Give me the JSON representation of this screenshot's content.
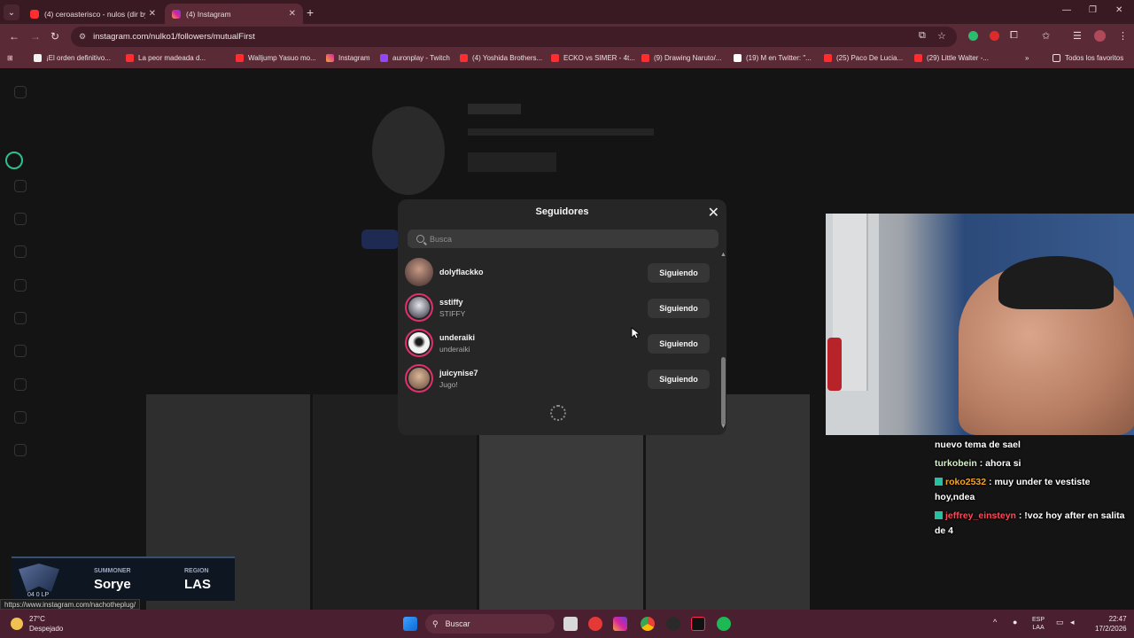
{
  "browser": {
    "tabs": [
      {
        "title": "(4) ceroasterisco - nulos (dir by",
        "active": false
      },
      {
        "title": "(4) Instagram",
        "active": true
      }
    ],
    "url": "instagram.com/nulko1/followers/mutualFirst",
    "bookmarks": [
      "¡El orden definitivo...",
      "La peor madeada d...",
      "Walljump Yasuo mo...",
      "Instagram",
      "auronplay - Twitch",
      "(4) Yoshida Brothers...",
      "ECKO vs SIMER - 4t...",
      "(9) Drawing Naruto/...",
      "(19) M en Twitter: \"...",
      "(25) Paco De Lucia...",
      "(29) Little Walter -..."
    ],
    "bookmarks_all": "Todos los favoritos"
  },
  "modal": {
    "title": "Seguidores",
    "search_placeholder": "Busca",
    "followers": [
      {
        "username": "dolyflackko",
        "fullname": "",
        "button": "Siguiendo"
      },
      {
        "username": "sstiffy",
        "fullname": "STIFFY",
        "button": "Siguiendo"
      },
      {
        "username": "underaiki",
        "fullname": "underaiki",
        "button": "Siguiendo"
      },
      {
        "username": "juicynise7",
        "fullname": "Jugo!",
        "button": "Siguiendo"
      }
    ]
  },
  "chat": [
    {
      "user": "",
      "message": "nuevo tema de sael"
    },
    {
      "user": "turkobein",
      "message": ": ahora si"
    },
    {
      "user": "roko2532",
      "message": ": muy under te vestiste hoy,ndea"
    },
    {
      "user": "jeffrey_einsteyn",
      "message": ": !voz hoy after en salita de 4"
    }
  ],
  "lol_overlay": {
    "lp": "0 LP",
    "lp_prefix": "04",
    "summoner_label": "SUMMONER",
    "summoner": "Sorye",
    "region_label": "REGION",
    "region": "LAS"
  },
  "status_url": "https://www.instagram.com/nachotheplug/",
  "taskbar": {
    "temp": "27°C",
    "weather": "Despejado",
    "search": "Buscar",
    "lang1": "ESP",
    "lang2": "LAA",
    "time": "22:47",
    "date": "17/2/2026"
  }
}
